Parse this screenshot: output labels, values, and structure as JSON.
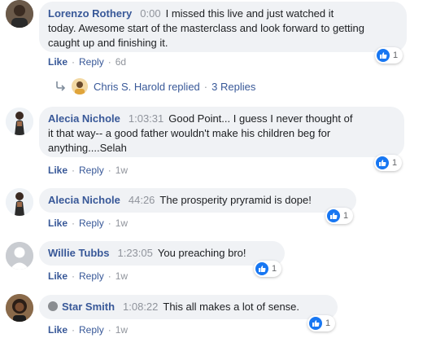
{
  "comments": [
    {
      "author": "Lorenzo Rothery",
      "time": "0:00",
      "text_lines": [
        "I missed this live and just watched it",
        "today. Awesome start of the masterclass and look forward to getting",
        "caught up and finishing it."
      ],
      "reaction_count": "1",
      "like": "Like",
      "reply": "Reply",
      "age": "6d"
    },
    {
      "author": "Alecia Nichole",
      "time": "1:03:31",
      "text_lines": [
        "Good Point... I guess I never thought of",
        "it that way-- a good father wouldn't make his children beg for",
        "anything....Selah"
      ],
      "reaction_count": "1",
      "like": "Like",
      "reply": "Reply",
      "age": "1w"
    },
    {
      "author": "Alecia Nichole",
      "time": "44:26",
      "text_lines": [
        "The prosperity pryramid is dope!"
      ],
      "reaction_count": "1",
      "like": "Like",
      "reply": "Reply",
      "age": "1w"
    },
    {
      "author": "Willie Tubbs",
      "time": "1:23:05",
      "text_lines": [
        "You preaching bro!"
      ],
      "reaction_count": "1",
      "like": "Like",
      "reply": "Reply",
      "age": "1w"
    },
    {
      "author": "Star Smith",
      "time": "1:08:22",
      "text_lines": [
        "This all makes a lot of sense."
      ],
      "reaction_count": "1",
      "like": "Like",
      "reply": "Reply",
      "age": "1w"
    }
  ],
  "replies_summary": {
    "replier": "Chris S. Harold replied",
    "count": "3 Replies",
    "separator": "·"
  },
  "colors": {
    "link": "#385898",
    "meta": "#90949c",
    "bubble": "#f0f2f5",
    "like_blue": "#1877f2"
  },
  "icons": {
    "like": "thumbs-up-icon",
    "reply_arrow": "reply-arrow-icon",
    "verified": "verified-badge-icon"
  }
}
